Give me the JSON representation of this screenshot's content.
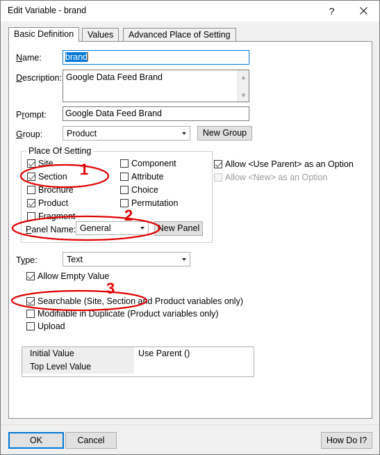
{
  "window": {
    "title": "Edit Variable - brand",
    "help_icon": "question-mark-icon",
    "close_icon": "close-x-icon"
  },
  "tabs": [
    {
      "label": "Basic Definition",
      "active": true
    },
    {
      "label": "Values",
      "active": false
    },
    {
      "label": "Advanced Place of Setting",
      "active": false
    }
  ],
  "form": {
    "name_label": "Name:",
    "name_value": "brand",
    "description_label": "Description:",
    "description_value": "Google Data Feed Brand",
    "prompt_label": "Prompt:",
    "prompt_value": "Google Data Feed Brand",
    "group_label": "Group:",
    "group_value": "Product",
    "new_group_button": "New Group"
  },
  "place_of_setting": {
    "title": "Place Of Setting",
    "left_checkboxes": [
      {
        "label": "Site",
        "checked": true
      },
      {
        "label": "Section",
        "checked": true
      },
      {
        "label": "Brochure",
        "checked": false
      },
      {
        "label": "Product",
        "checked": true
      },
      {
        "label": "Fragment",
        "checked": false
      }
    ],
    "right_checkboxes": [
      {
        "label": "Component",
        "checked": false
      },
      {
        "label": "Attribute",
        "checked": false
      },
      {
        "label": "Choice",
        "checked": false
      },
      {
        "label": "Permutation",
        "checked": false
      }
    ],
    "panel_name_label": "Panel Name:",
    "panel_name_value": "General",
    "new_panel_button": "New Panel"
  },
  "options": {
    "allow_use_parent": {
      "label": "Allow <Use Parent> as an Option",
      "checked": true,
      "disabled": false
    },
    "allow_new": {
      "label": "Allow <New> as an Option",
      "checked": false,
      "disabled": true
    }
  },
  "type_section": {
    "type_label": "Type:",
    "type_value": "Text",
    "checkboxes": [
      {
        "label": "Allow Empty Value",
        "checked": true
      },
      {
        "label": "Searchable (Site, Section and Product variables only)",
        "checked": true
      },
      {
        "label": "Modifiable in Duplicate (Product variables only)",
        "checked": false
      },
      {
        "label": "Upload",
        "checked": false
      }
    ]
  },
  "value_table": {
    "rows": [
      {
        "label": "Initial Value",
        "value": "Use Parent ()"
      },
      {
        "label": "Top Level Value",
        "value": ""
      }
    ]
  },
  "footer": {
    "ok_button": "OK",
    "cancel_button": "Cancel",
    "how_do_i_button": "How Do I?"
  },
  "annotations": {
    "color": "#e00000",
    "markers": [
      {
        "number": "1",
        "target": "section-checkbox"
      },
      {
        "number": "2",
        "target": "panel-name-combo"
      },
      {
        "number": "3",
        "target": "searchable-checkbox"
      }
    ]
  }
}
